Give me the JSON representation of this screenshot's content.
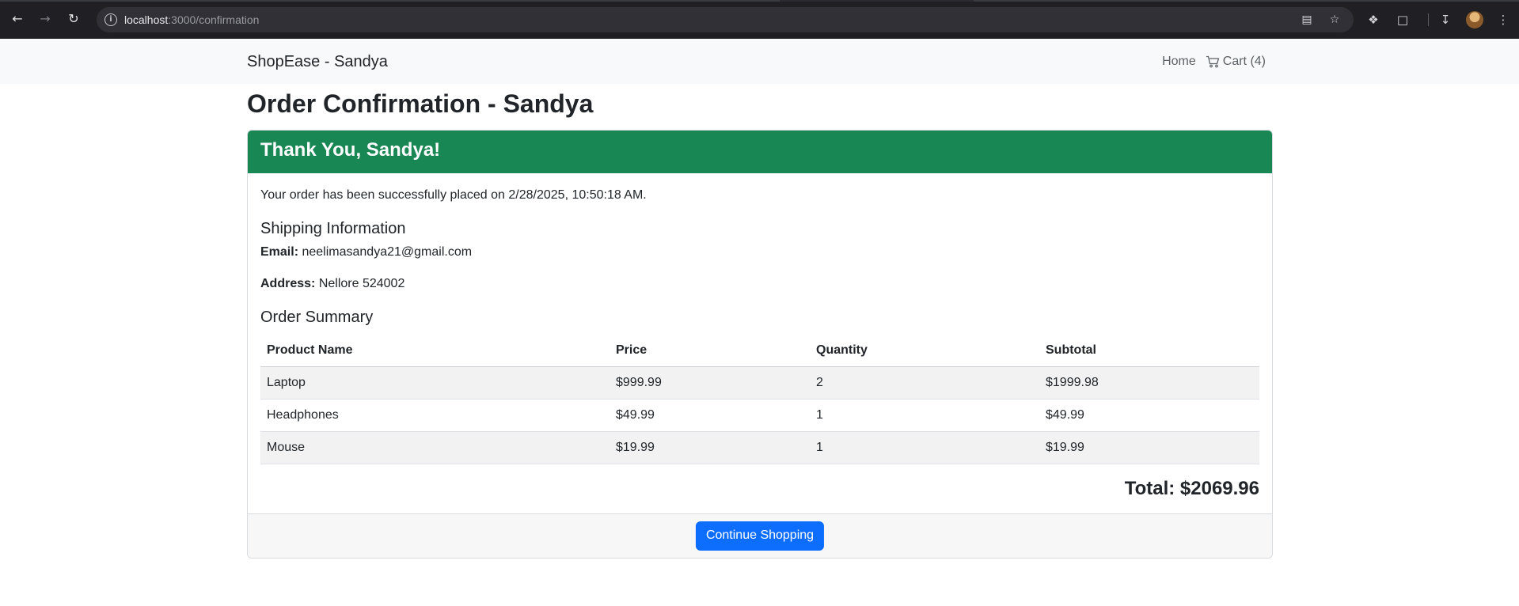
{
  "browser": {
    "url_host": "localhost",
    "url_path": ":3000/confirmation"
  },
  "navbar": {
    "brand": "ShopEase - Sandya",
    "home_label": "Home",
    "cart_label": "Cart (4)"
  },
  "page": {
    "title": "Order Confirmation - Sandya"
  },
  "card": {
    "header": "Thank You, Sandya!",
    "placed_message": "Your order has been successfully placed on 2/28/2025, 10:50:18 AM.",
    "shipping_title": "Shipping Information",
    "email_label": "Email:",
    "email_value": "neelimasandya21@gmail.com",
    "address_label": "Address:",
    "address_value": "Nellore 524002",
    "summary_title": "Order Summary",
    "columns": [
      "Product Name",
      "Price",
      "Quantity",
      "Subtotal"
    ],
    "rows": [
      {
        "name": "Laptop",
        "price": "$999.99",
        "qty": "2",
        "subtotal": "$1999.98"
      },
      {
        "name": "Headphones",
        "price": "$49.99",
        "qty": "1",
        "subtotal": "$49.99"
      },
      {
        "name": "Mouse",
        "price": "$19.99",
        "qty": "1",
        "subtotal": "$19.99"
      }
    ],
    "total": "Total: $2069.96",
    "continue_label": "Continue Shopping"
  },
  "colors": {
    "header_green": "#198754",
    "primary_blue": "#0d6efd"
  }
}
